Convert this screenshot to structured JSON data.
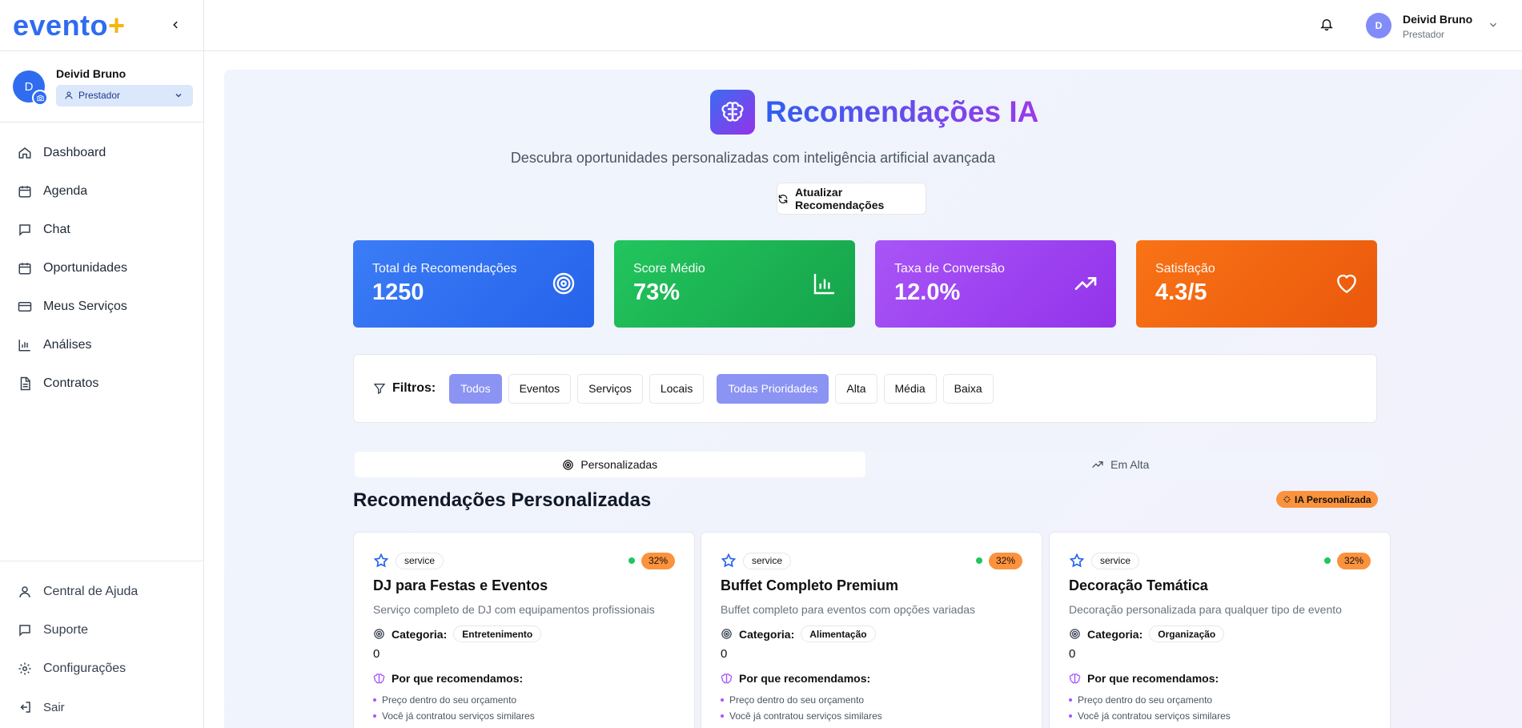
{
  "brand": {
    "name": "evento",
    "plus": "+"
  },
  "sidebar": {
    "user": {
      "initial": "D",
      "name": "Deivid Bruno",
      "role": "Prestador"
    },
    "nav": [
      {
        "label": "Dashboard",
        "icon": "home-icon"
      },
      {
        "label": "Agenda",
        "icon": "calendar-icon"
      },
      {
        "label": "Chat",
        "icon": "chat-icon"
      },
      {
        "label": "Oportunidades",
        "icon": "calendar-icon"
      },
      {
        "label": "Meus Serviços",
        "icon": "credit-card-icon"
      },
      {
        "label": "Análises",
        "icon": "bar-chart-icon"
      },
      {
        "label": "Contratos",
        "icon": "document-icon"
      }
    ],
    "bottom_nav": [
      {
        "label": "Central de Ajuda",
        "icon": "user-icon"
      },
      {
        "label": "Suporte",
        "icon": "chat-icon"
      },
      {
        "label": "Configurações",
        "icon": "gear-icon"
      },
      {
        "label": "Sair",
        "icon": "logout-icon"
      }
    ]
  },
  "header": {
    "initial": "D",
    "name": "Deivid Bruno",
    "role": "Prestador"
  },
  "hero": {
    "title": "Recomendações IA",
    "subtitle": "Descubra oportunidades personalizadas com inteligência artificial avançada",
    "refresh_label": "Atualizar Recomendações"
  },
  "stats": [
    {
      "label": "Total de Recomendações",
      "value": "1250",
      "icon": "target-icon",
      "color": "#2563eb"
    },
    {
      "label": "Score Médio",
      "value": "73%",
      "icon": "bar-chart-icon",
      "color": "#16a34a"
    },
    {
      "label": "Taxa de Conversão",
      "value": "12.0%",
      "icon": "trending-up-icon",
      "color": "#9333ea"
    },
    {
      "label": "Satisfação",
      "value": "4.3/5",
      "icon": "heart-icon",
      "color": "#ea580c"
    }
  ],
  "filters": {
    "label": "Filtros:",
    "types": [
      "Todos",
      "Eventos",
      "Serviços",
      "Locais"
    ],
    "priorities": [
      "Todas Prioridades",
      "Alta",
      "Média",
      "Baixa"
    ],
    "active_type": "Todos",
    "active_priority": "Todas Prioridades"
  },
  "tabs": [
    {
      "label": "Personalizadas",
      "active": true
    },
    {
      "label": "Em Alta",
      "active": false
    }
  ],
  "section": {
    "title": "Recomendações Personalizadas",
    "badge": "IA Personalizada"
  },
  "cards": [
    {
      "type": "service",
      "score": "32%",
      "title": "DJ para Festas e Eventos",
      "description": "Serviço completo de DJ com equipamentos profissionais",
      "category_label": "Categoria:",
      "category": "Entretenimento",
      "count": "0",
      "why_label": "Por que recomendamos:",
      "reasons": [
        "Preço dentro do seu orçamento",
        "Você já contratou serviços similares"
      ]
    },
    {
      "type": "service",
      "score": "32%",
      "title": "Buffet Completo Premium",
      "description": "Buffet completo para eventos com opções variadas",
      "category_label": "Categoria:",
      "category": "Alimentação",
      "count": "0",
      "why_label": "Por que recomendamos:",
      "reasons": [
        "Preço dentro do seu orçamento",
        "Você já contratou serviços similares"
      ]
    },
    {
      "type": "service",
      "score": "32%",
      "title": "Decoração Temática",
      "description": "Decoração personalizada para qualquer tipo de evento",
      "category_label": "Categoria:",
      "category": "Organização",
      "count": "0",
      "why_label": "Por que recomendamos:",
      "reasons": [
        "Preço dentro do seu orçamento",
        "Você já contratou serviços similares"
      ]
    }
  ]
}
